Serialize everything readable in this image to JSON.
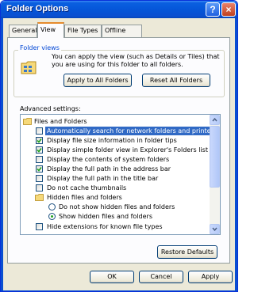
{
  "window": {
    "title": "Folder Options",
    "help_label": "?",
    "close_label": "×"
  },
  "tabs": [
    {
      "label": "General",
      "active": false
    },
    {
      "label": "View",
      "active": true
    },
    {
      "label": "File Types",
      "active": false
    },
    {
      "label": "Offline Files",
      "active": false
    }
  ],
  "folder_views": {
    "legend": "Folder views",
    "description": "You can apply the view (such as Details or Tiles) that you are using for this folder to all folders.",
    "apply_button": "Apply to All Folders",
    "reset_button": "Reset All Folders"
  },
  "advanced": {
    "label": "Advanced settings:",
    "items": [
      {
        "type": "folder",
        "label": "Files and Folders",
        "indent": 0,
        "checked": false,
        "selected": false
      },
      {
        "type": "checkbox",
        "label": "Automatically search for network folders and printers",
        "indent": 1,
        "checked": false,
        "selected": true
      },
      {
        "type": "checkbox",
        "label": "Display file size information in folder tips",
        "indent": 1,
        "checked": true,
        "selected": false
      },
      {
        "type": "checkbox",
        "label": "Display simple folder view in Explorer's Folders list",
        "indent": 1,
        "checked": true,
        "selected": false
      },
      {
        "type": "checkbox",
        "label": "Display the contents of system folders",
        "indent": 1,
        "checked": false,
        "selected": false
      },
      {
        "type": "checkbox",
        "label": "Display the full path in the address bar",
        "indent": 1,
        "checked": true,
        "selected": false
      },
      {
        "type": "checkbox",
        "label": "Display the full path in the title bar",
        "indent": 1,
        "checked": false,
        "selected": false
      },
      {
        "type": "checkbox",
        "label": "Do not cache thumbnails",
        "indent": 1,
        "checked": false,
        "selected": false
      },
      {
        "type": "folder",
        "label": "Hidden files and folders",
        "indent": 1,
        "checked": false,
        "selected": false
      },
      {
        "type": "radio",
        "label": "Do not show hidden files and folders",
        "indent": 2,
        "checked": false,
        "selected": false
      },
      {
        "type": "radio",
        "label": "Show hidden files and folders",
        "indent": 2,
        "checked": true,
        "selected": false
      },
      {
        "type": "checkbox",
        "label": "Hide extensions for known file types",
        "indent": 1,
        "checked": false,
        "selected": false
      }
    ]
  },
  "restore_button": "Restore Defaults",
  "footer": {
    "ok": "OK",
    "cancel": "Cancel",
    "apply": "Apply"
  },
  "colors": {
    "titlebar": "#0a5fe0",
    "selection": "#316ac5",
    "check": "#21a121",
    "dialog_bg": "#ece9d8"
  }
}
